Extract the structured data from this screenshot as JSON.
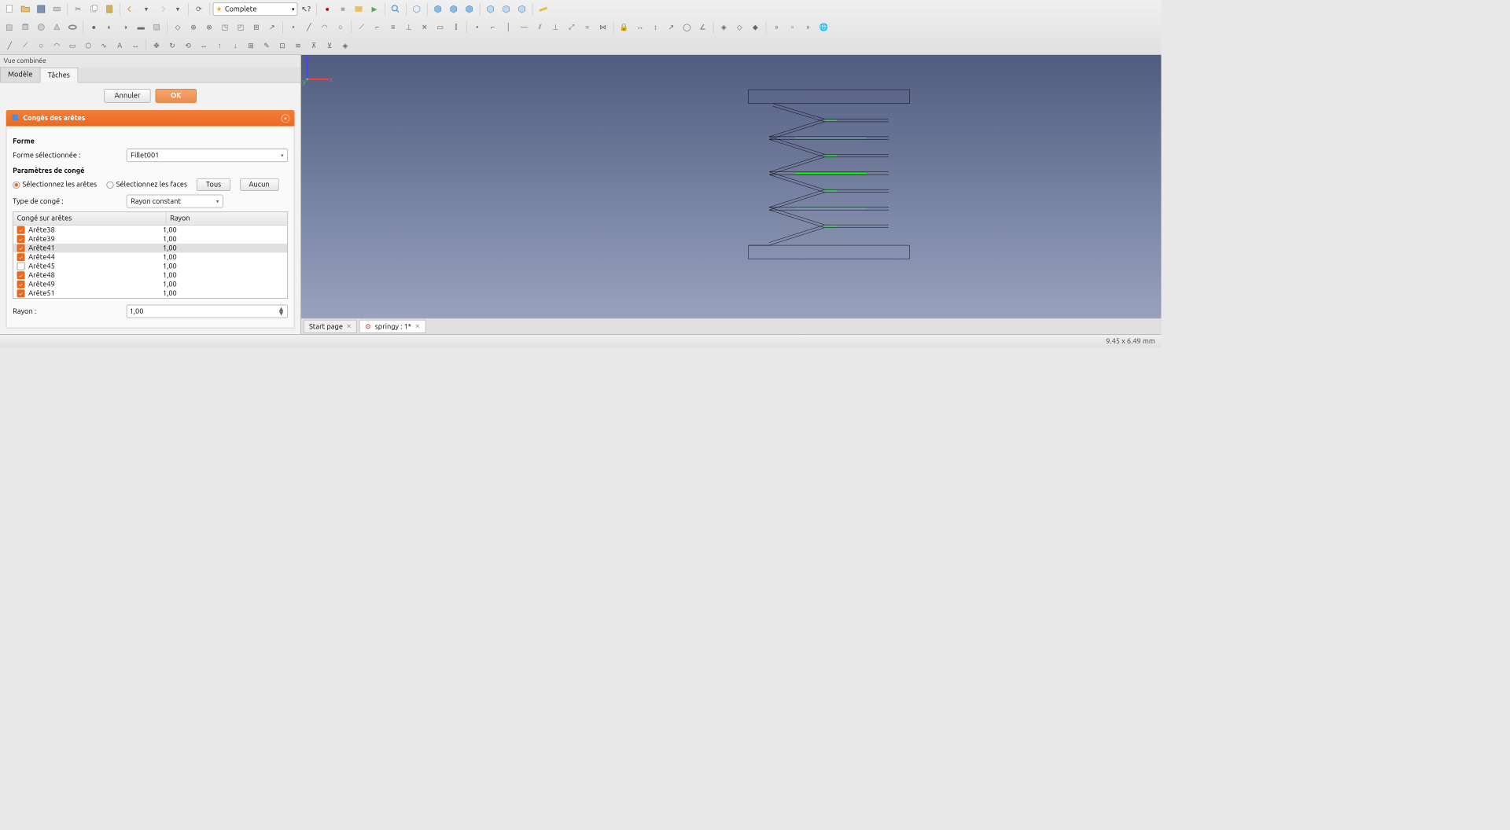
{
  "workbench": "Complete",
  "panel": {
    "title": "Vue combinée",
    "tabs": [
      "Modèle",
      "Tâches"
    ],
    "active_tab": 1
  },
  "buttons": {
    "cancel": "Annuler",
    "ok": "OK",
    "all": "Tous",
    "none": "Aucun"
  },
  "task": {
    "title": "Congés des arêtes",
    "section_shape": "Forme",
    "shape_selected_label": "Forme sélectionnée :",
    "shape_selected_value": "Fillet001",
    "section_params": "Paramètres de congé",
    "radio_edges": "Sélectionnez les arêtes",
    "radio_faces": "Sélectionnez les faces",
    "type_label": "Type de congé :",
    "type_value": "Rayon constant",
    "table": {
      "col_edge": "Congé sur arêtes",
      "col_rayon": "Rayon",
      "rows": [
        {
          "name": "Arête38",
          "rayon": "1,00",
          "checked": true,
          "selected": false
        },
        {
          "name": "Arête39",
          "rayon": "1,00",
          "checked": true,
          "selected": false
        },
        {
          "name": "Arête41",
          "rayon": "1,00",
          "checked": true,
          "selected": true
        },
        {
          "name": "Arête44",
          "rayon": "1,00",
          "checked": true,
          "selected": false
        },
        {
          "name": "Arête45",
          "rayon": "1,00",
          "checked": false,
          "selected": false
        },
        {
          "name": "Arête48",
          "rayon": "1,00",
          "checked": true,
          "selected": false
        },
        {
          "name": "Arête49",
          "rayon": "1,00",
          "checked": true,
          "selected": false
        },
        {
          "name": "Arête51",
          "rayon": "1,00",
          "checked": true,
          "selected": false
        }
      ]
    },
    "rayon_label": "Rayon :",
    "rayon_value": "1,00"
  },
  "doc_tabs": [
    {
      "label": "Start page",
      "active": false
    },
    {
      "label": "springy : 1*",
      "active": true
    }
  ],
  "status": "9.45 x 6.49 mm",
  "axes": {
    "x": "x",
    "y": "y",
    "z": "z"
  }
}
